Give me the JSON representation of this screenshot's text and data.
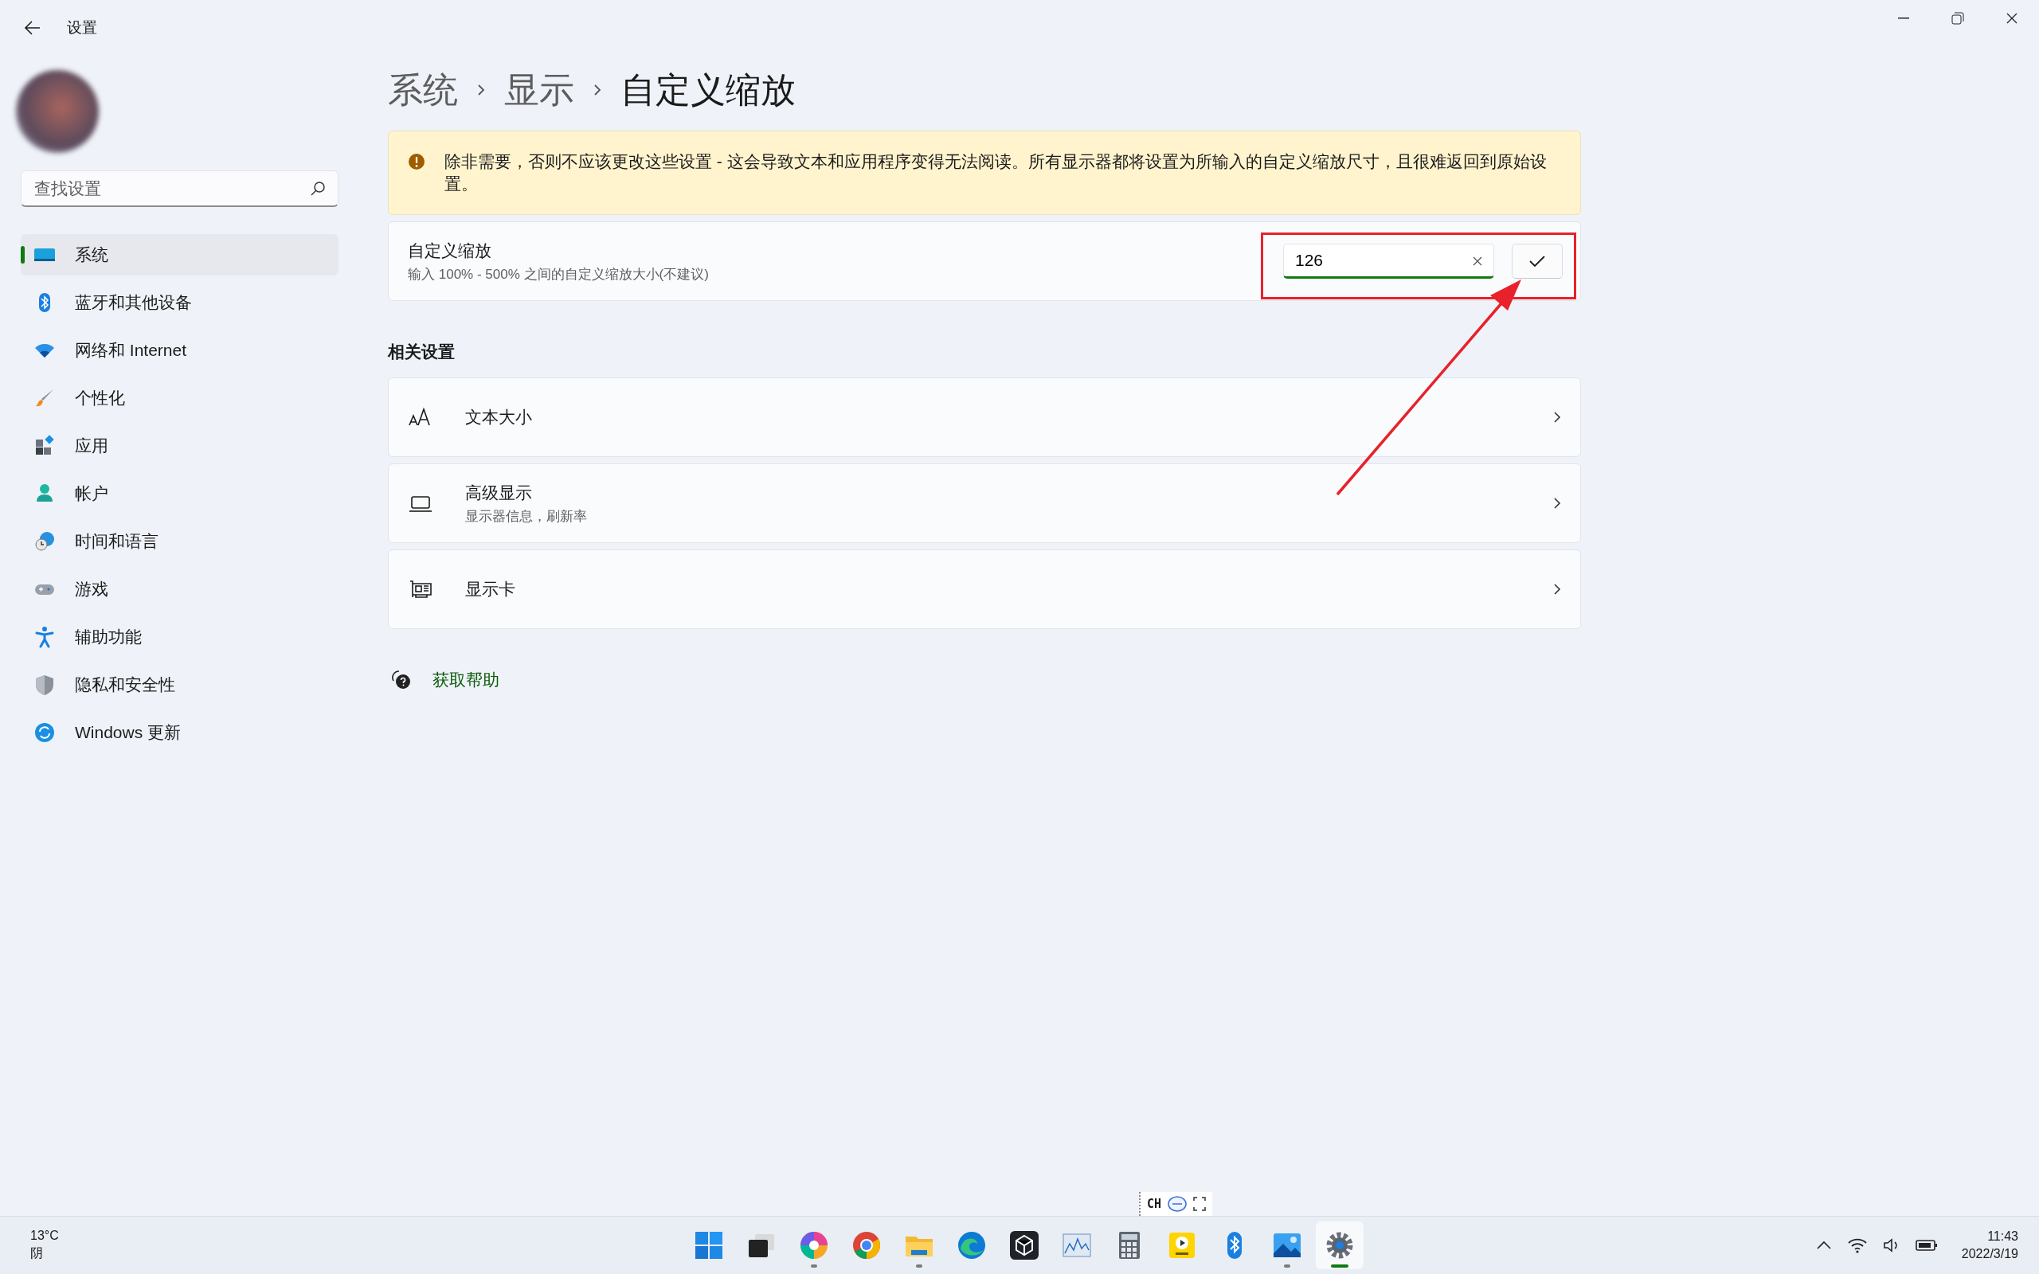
{
  "window": {
    "title": "设置"
  },
  "sidebar": {
    "search": {
      "placeholder": "查找设置"
    },
    "items": [
      {
        "kind": "system",
        "label": "系统",
        "selected": true
      },
      {
        "kind": "bluetooth",
        "label": "蓝牙和其他设备",
        "selected": false
      },
      {
        "kind": "network",
        "label": "网络和 Internet",
        "selected": false
      },
      {
        "kind": "personalize",
        "label": "个性化",
        "selected": false
      },
      {
        "kind": "apps",
        "label": "应用",
        "selected": false
      },
      {
        "kind": "account",
        "label": "帐户",
        "selected": false
      },
      {
        "kind": "time",
        "label": "时间和语言",
        "selected": false
      },
      {
        "kind": "gaming",
        "label": "游戏",
        "selected": false
      },
      {
        "kind": "accessibility",
        "label": "辅助功能",
        "selected": false
      },
      {
        "kind": "privacy",
        "label": "隐私和安全性",
        "selected": false
      },
      {
        "kind": "update",
        "label": "Windows 更新",
        "selected": false
      }
    ]
  },
  "breadcrumb": [
    "系统",
    "显示",
    "自定义缩放"
  ],
  "warning": "除非需要，否则不应该更改这些设置 - 这会导致文本和应用程序变得无法阅读。所有显示器都将设置为所输入的自定义缩放尺寸，且很难返回到原始设置。",
  "custom_scaling": {
    "title": "自定义缩放",
    "description": "输入 100% - 500% 之间的自定义缩放大小(不建议)",
    "value": "126"
  },
  "related": {
    "heading": "相关设置",
    "items": [
      {
        "kind": "text-size",
        "title": "文本大小"
      },
      {
        "kind": "monitor",
        "title": "高级显示",
        "subtitle": "显示器信息，刷新率"
      },
      {
        "kind": "gpu",
        "title": "显示卡"
      }
    ]
  },
  "help": "获取帮助",
  "ime": "CH",
  "taskbar": {
    "weather": {
      "temp": "13°C",
      "condition": "阴"
    },
    "apps": [
      {
        "kind": "start",
        "running": false,
        "selected": false
      },
      {
        "kind": "taskview",
        "running": false,
        "selected": false
      },
      {
        "kind": "pinwheel",
        "running": true,
        "selected": false
      },
      {
        "kind": "chrome",
        "running": false,
        "selected": false
      },
      {
        "kind": "folder",
        "running": true,
        "selected": false
      },
      {
        "kind": "edge",
        "running": false,
        "selected": false
      },
      {
        "kind": "cube",
        "running": false,
        "selected": false
      },
      {
        "kind": "chart",
        "running": false,
        "selected": false
      },
      {
        "kind": "calculator",
        "running": false,
        "selected": false
      },
      {
        "kind": "player",
        "running": false,
        "selected": false
      },
      {
        "kind": "bluetooth",
        "running": false,
        "selected": false
      },
      {
        "kind": "photos",
        "running": true,
        "selected": false
      },
      {
        "kind": "settings",
        "running": true,
        "selected": true
      }
    ],
    "time": "11:43",
    "date": "2022/3/19"
  }
}
